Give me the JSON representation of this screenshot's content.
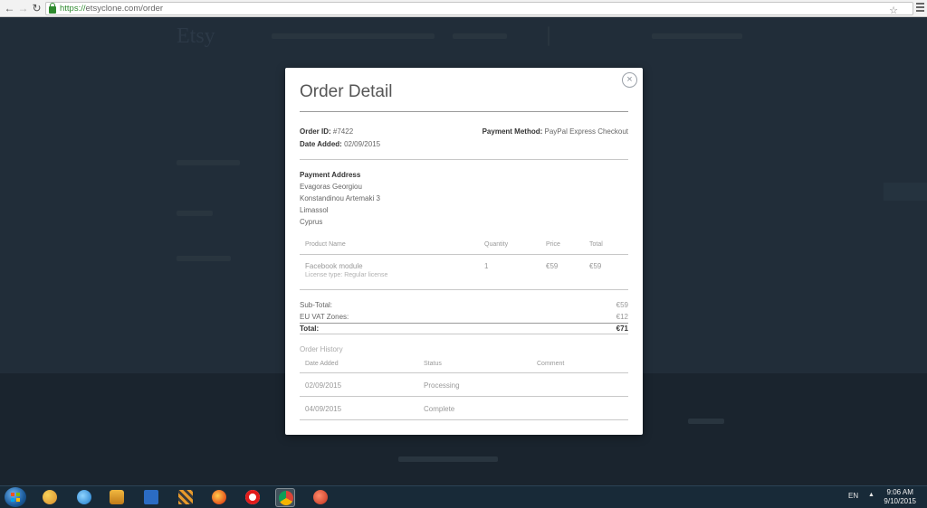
{
  "browser": {
    "back_icon": "arrow-left-icon",
    "forward_icon": "arrow-right-icon",
    "reload_icon": "reload-icon",
    "url_scheme": "https://",
    "url_rest": "etsyclone.com/order"
  },
  "background_page": {
    "logo": "Etsy"
  },
  "modal": {
    "title": "Order Detail",
    "close_label": "×",
    "order_id_label": "Order ID:",
    "order_id_value": "#7422",
    "date_added_label": "Date Added:",
    "date_added_value": "02/09/2015",
    "payment_method_label": "Payment Method:",
    "payment_method_value": "PayPal Express Checkout",
    "payment_address": {
      "heading": "Payment Address",
      "lines": [
        "Evagoras Georgiou",
        "Konstandinou Artemaki 3",
        "Limassol",
        "Cyprus"
      ]
    },
    "products": {
      "headers": [
        "Product Name",
        "Quantity",
        "Price",
        "Total"
      ],
      "rows": [
        {
          "name": "Facebook module",
          "option": "License type: Regular license",
          "quantity": "1",
          "price": "€59",
          "total": "€59"
        }
      ]
    },
    "totals": [
      {
        "label": "Sub-Total:",
        "value": "€59"
      },
      {
        "label": "EU VAT Zones:",
        "value": "€12"
      },
      {
        "label": "Total:",
        "value": "€71"
      }
    ],
    "history": {
      "heading": "Order History",
      "headers": [
        "Date Added",
        "Status",
        "Comment"
      ],
      "rows": [
        {
          "date": "02/09/2015",
          "status": "Processing",
          "comment": ""
        },
        {
          "date": "04/09/2015",
          "status": "Complete",
          "comment": ""
        }
      ]
    }
  },
  "taskbar": {
    "language": "EN",
    "time": "9:06 AM",
    "date": "9/10/2015",
    "apps": [
      "paint-icon",
      "internet-explorer-icon",
      "media-player-icon",
      "accessibility-icon",
      "pixel-app-icon",
      "firefox-icon",
      "opera-icon",
      "chrome-icon",
      "filezilla-icon"
    ]
  }
}
